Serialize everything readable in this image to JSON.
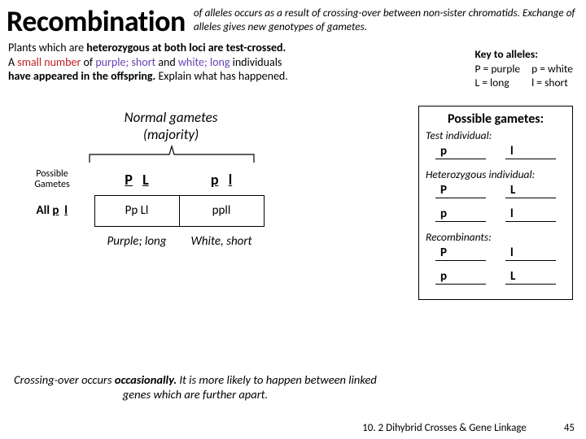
{
  "title": "Recombination",
  "title_desc": "of alleles occurs as a result of crossing-over between non-sister chromatids. Exchange of alleles gives new genotypes of gametes.",
  "intro": {
    "l1a": "Plants which are ",
    "l1b": "heterozygous at both loci are test-crossed.",
    "l2a": "A ",
    "l2b": "small number",
    "l2c": " of ",
    "l2d": "purple; short",
    "l2e": " and ",
    "l2f": "white; long",
    "l2g": " individuals",
    "l3a": "have appeared in the offspring.",
    "l3b": " Explain what has happened."
  },
  "key": {
    "title": "Key to alleles:",
    "c": [
      "P = purple",
      "p = white",
      "L = long",
      "l  = short"
    ]
  },
  "normal_head1": "Normal gametes",
  "normal_head2": "(majority)",
  "table": {
    "side_lab": "Possible\nGametes",
    "side_all_pre": "All ",
    "side_all_a": "p",
    "side_all_b": "l",
    "h1a": "P",
    "h1b": "L",
    "h2a": "p",
    "h2b": "l",
    "c1": "Pp Ll",
    "c2": "ppll",
    "p1": "Purple; long",
    "p2": "White, short"
  },
  "gbox": {
    "title": "Possible gametes:",
    "sub1": "Test individual:",
    "t": [
      "p",
      "l"
    ],
    "sub2": "Heterozygous individual:",
    "h1": [
      "P",
      "L"
    ],
    "h2": [
      "p",
      "l"
    ],
    "sub3": "Recombinants:",
    "r1": [
      "P",
      "l"
    ],
    "r2": [
      "p",
      "L"
    ]
  },
  "cross_note": {
    "a": "Crossing-over occurs ",
    "b": "occasionally.",
    "c": " It is more likely to happen between linked genes which are further apart."
  },
  "footer": {
    "src": "10. 2 Dihybrid Crosses & Gene Linkage",
    "page": "45"
  }
}
